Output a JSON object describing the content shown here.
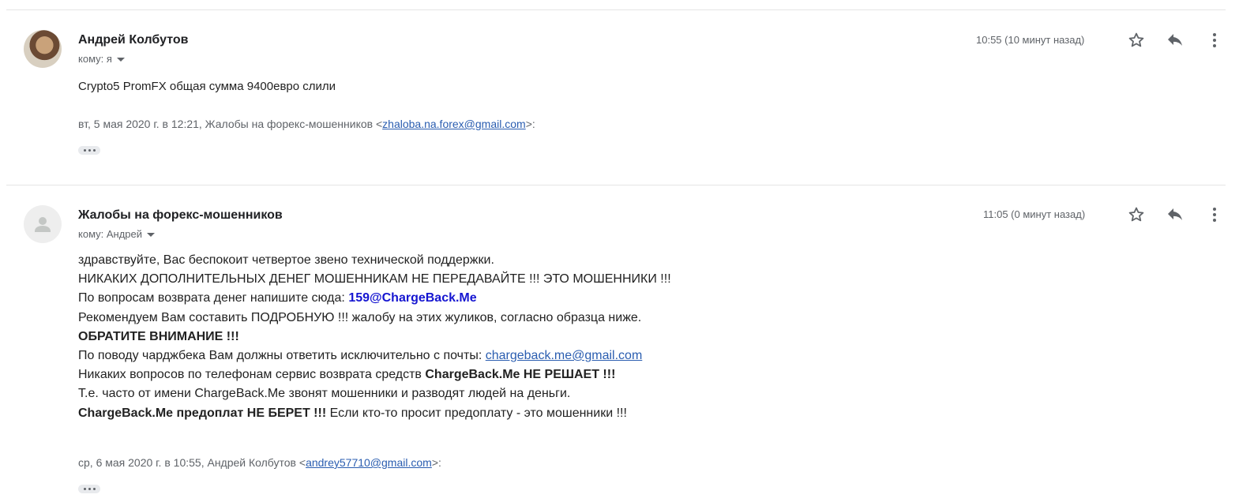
{
  "messages": [
    {
      "sender": "Андрей Колбутов",
      "to": "кому: я",
      "time": "10:55 (10 минут назад)",
      "body": "Crypto5 PromFX общая сумма 9400евро слили",
      "quote_prefix": "вт, 5 мая 2020 г. в 12:21, Жалобы на форекс-мошенников <",
      "quote_email": "zhaloba.na.forex@gmail.com",
      "quote_suffix": ">:"
    },
    {
      "sender": "Жалобы на форекс-мошенников",
      "to": "кому: Андрей",
      "time": "11:05 (0 минут назад)",
      "lines": {
        "l1": "здравствуйте, Вас беспокоит четвертое звено технической поддержки.",
        "l2": "НИКАКИХ ДОПОЛНИТЕЛЬНЫХ ДЕНЕГ МОШЕННИКАМ НЕ ПЕРЕДАВАЙТЕ !!! ЭТО МОШЕННИКИ !!!",
        "l3_text": "По вопросам возврата денег напишите сюда: ",
        "l3_email": "159@ChargeBack.Me",
        "l4": "Рекомендуем Вам составить ПОДРОБНУЮ !!! жалобу на этих жуликов, согласно образца ниже.",
        "l5": "ОБРАТИТЕ ВНИМАНИЕ !!!",
        "l6_text": "По поводу чарджбека Вам должны ответить исключительно с почты: ",
        "l6_email": "chargeback.me@gmail.com",
        "l7_text": "Никаких вопросов по телефонам сервис возврата средств ",
        "l7_bold": "ChargeBack.Me НЕ РЕШАЕТ !!!",
        "l8": "Т.е. часто от имени ChargeBack.Me звонят мошенники и разводят людей на деньги.",
        "l9_bold": "ChargeBack.Me предоплат НЕ БЕРЕТ !!!",
        "l9_text": " Если кто-то просит предоплату - это мошенники !!!"
      },
      "quote_prefix": "ср, 6 мая 2020 г. в 10:55, Андрей Колбутов <",
      "quote_email": "andrey57710@gmail.com",
      "quote_suffix": ">:"
    }
  ],
  "icons": [
    "star-icon",
    "reply-icon",
    "more-vert-icon",
    "person-icon",
    "chevron-down-icon"
  ]
}
